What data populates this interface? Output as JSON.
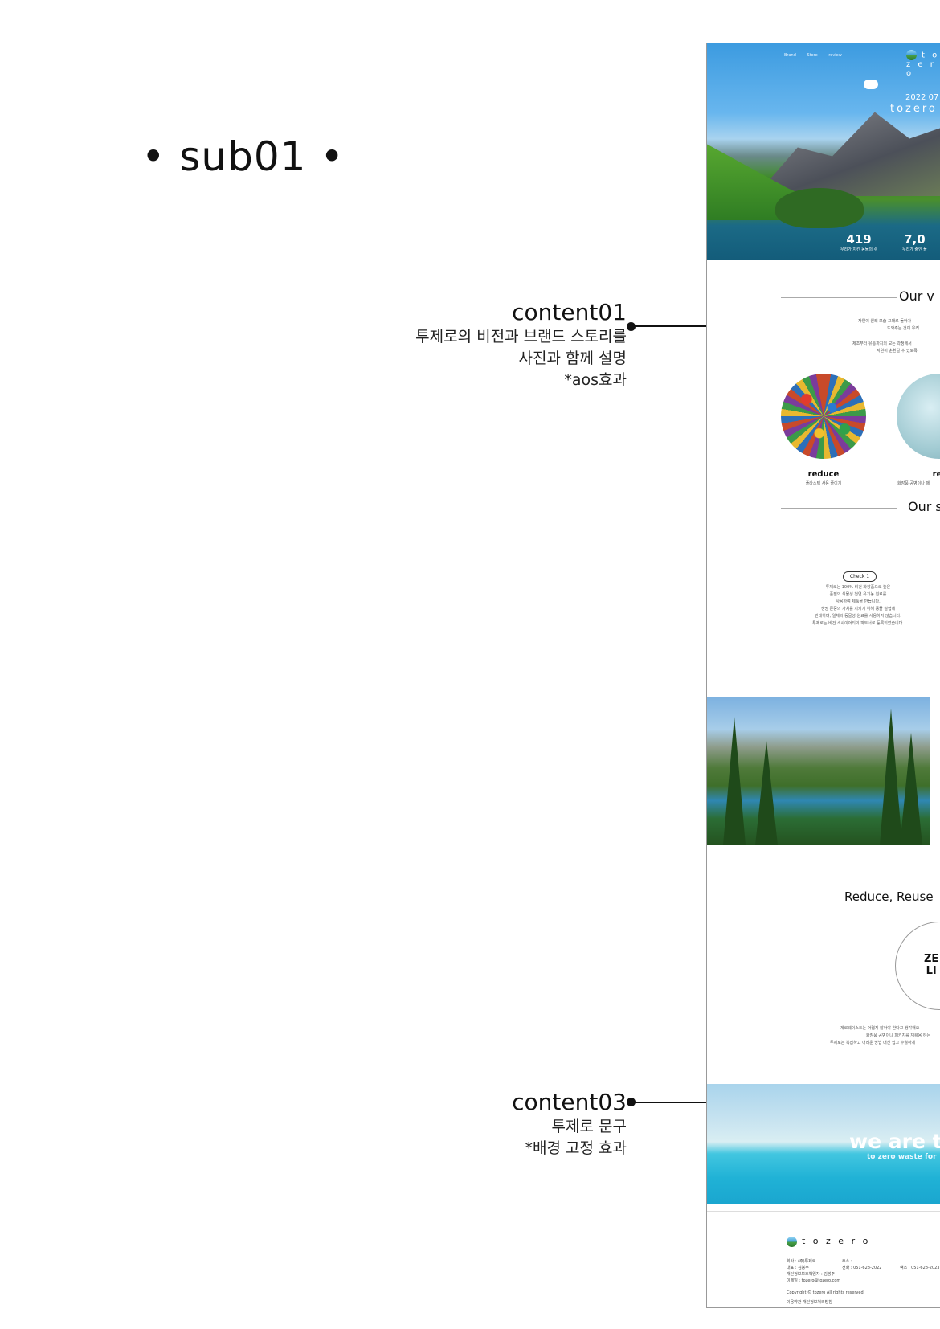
{
  "page_title": "• sub01 •",
  "annotations": {
    "content01": {
      "head": "content01",
      "lines": [
        "투제로의 비전과 브랜드 스토리를",
        "사진과  함께 설명",
        "*aos효과"
      ]
    },
    "content03": {
      "head": "content03",
      "lines": [
        "투제로 문구",
        "*배경 고정 효과"
      ]
    }
  },
  "mock": {
    "nav": [
      "Brand",
      "Store",
      "review"
    ],
    "logo": "t o z e r o",
    "hero_date": "2022 07",
    "hero_brand": "tozero",
    "stats": [
      {
        "num": "419",
        "cap": "우리가 지킨 동물의 수"
      },
      {
        "num": "7,0",
        "cap": "우리가 줄인 플"
      }
    ],
    "vision_title": "Our v",
    "vision_lines": [
      "자연이 원래 모습 그대로 돌아가",
      "도와주는 것이 우리",
      "",
      "제조부터 유통까지의 모든 과정에서",
      "자원이 순환될 수 있도록"
    ],
    "items": [
      {
        "name": "reduce",
        "sub": "플라스틱 사용 줄이기"
      },
      {
        "name": "reu",
        "sub": "화장품 공병이나 패"
      }
    ],
    "story_title": "Our s",
    "check_label": "Check 1",
    "check_lines": [
      "투제로는 100% 비건 화장품으로 높은",
      "품질의 식물성 천연 유기농 원료를",
      "사용하여 제품을 만듭니다.",
      "생명 존중의 가치를 지키기 위해 동물 실험에",
      "반대하며, 일체의 동물성 원료를 사용하지 않습니다.",
      "투제로는 비건 소사이어티의 파트너로 등록되었습니다."
    ],
    "rrr_title": "Reduce, Reuse",
    "zero_lines": [
      "ZE",
      "LI"
    ],
    "zero_desc": [
      "제로웨이스트는 어렵지 않아야 한다고 생각해요",
      "화장품 공병이나 패키지를 재활용 하는",
      "투제로는 복잡하고 어려운 방법 대신 쉽고 수월하게"
    ],
    "we_are": "we are t",
    "to_zero": "to zero waste for",
    "footer_logo": "t o z e r o",
    "footer_lines": [
      "회사 : (주)투제로",
      "대표 : 김봉주",
      "개인정보보호책임자 : 김봉주",
      "이메일 : tozero@tozero.com"
    ],
    "footer_addr": [
      "주소 :",
      "전화 : 051-628-2022"
    ],
    "footer_fax": "팩스 : 051-628-2023",
    "copyright": "Copyright © tozero All rights reserved.",
    "policy": "이용약관   개인정보처리방침"
  }
}
